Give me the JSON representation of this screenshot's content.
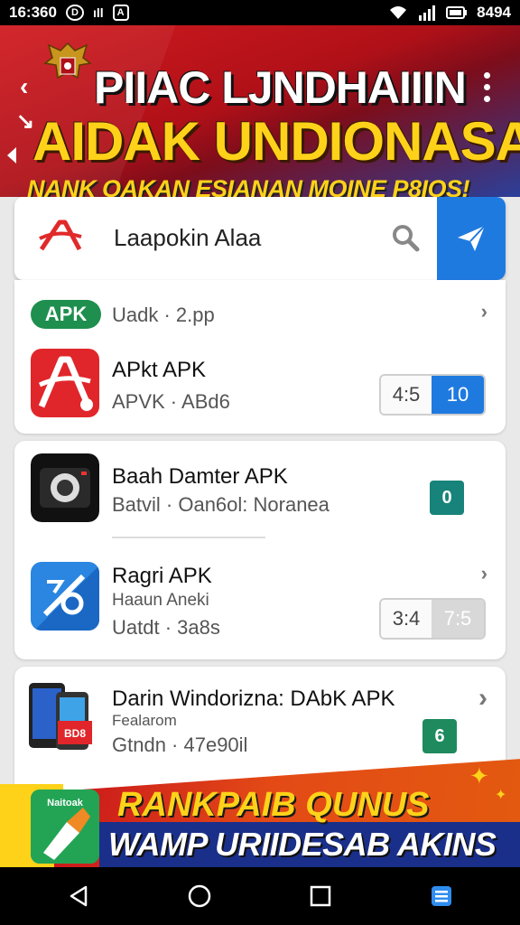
{
  "status_bar": {
    "time": "16:360",
    "left_icons": [
      "circle-d-icon",
      "signal-bars-icon",
      "notification-a-icon"
    ],
    "right_icons": [
      "wifi-icon",
      "signal-icon",
      "battery-icon"
    ],
    "battery_text": "8494"
  },
  "banner": {
    "title_line1": "PIIAC LJNDHAIIIN",
    "title_line2": "AIDAK UNDIONASA",
    "subtitle": "NANK OAKAN ESIANAN MOINE P8IOS!",
    "colors": {
      "red": "#d01a1f",
      "blue": "#2b3f9a",
      "yellow": "#ffd21a"
    }
  },
  "search": {
    "value": "Laapokin Alaa",
    "button_color": "#1f7ae0"
  },
  "card1": {
    "badge": "APK",
    "meta": "Uadk · 2.pp",
    "app_name": "APkt APK",
    "app_meta": "APVK · ABd6",
    "pill_left": "4:5",
    "pill_right": "10"
  },
  "card2": {
    "app1_name": "Baah Damter APK",
    "app1_meta": "Batvil · Oan6ol: Noranea",
    "app1_badge": "0",
    "app2_name": "Ragri APK",
    "app2_meta1": "Haaun Aneki",
    "app2_meta2": "Uatdt · 3a8s",
    "pill_left": "3:4",
    "pill_right": "7:5"
  },
  "card3": {
    "app_name": "Darin Windorizna: DAbK APK",
    "meta1": "Fealarom",
    "meta2": "Gtndn · 47e90il",
    "badge": "6",
    "phone_badge": "BD8"
  },
  "promo": {
    "icon_label": "Naitoak",
    "line1": "RANKPAIB QUNUS",
    "line2": "WAMP URIIDESAB AKINS"
  }
}
